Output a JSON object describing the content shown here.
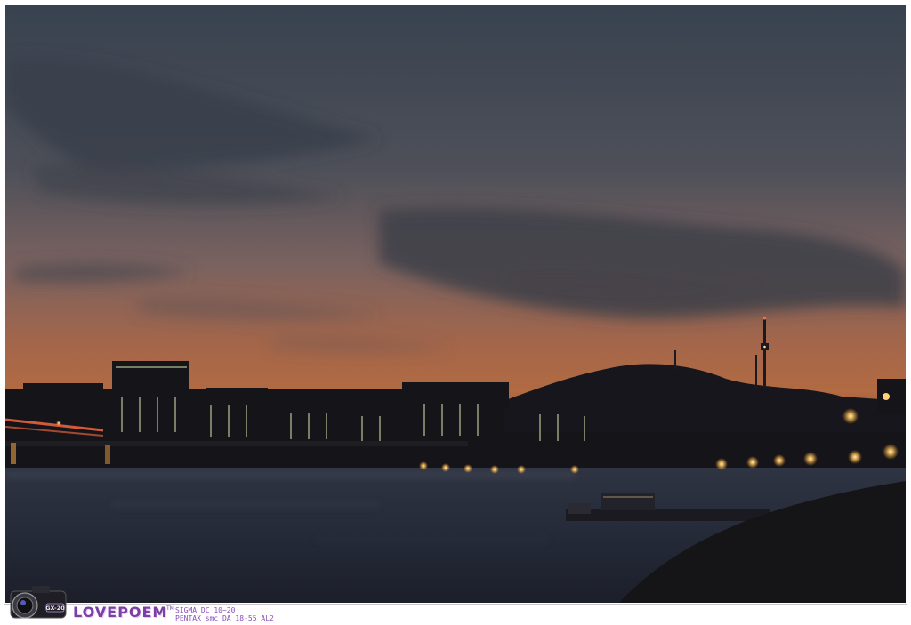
{
  "watermark": {
    "brand": "LOVEPOEM",
    "trademark": "TM",
    "camera_model": "GX-20",
    "lens_line_1": "SIGMA DC 10~20",
    "lens_line_2": "PENTAX smc DA 18-55 AL2"
  },
  "colors": {
    "sky_top": "#3b4653",
    "sky_mid": "#5e5a62",
    "sky_horizon": "#b06a43",
    "city_silhouette": "#16161d",
    "water": "#2b3140",
    "light_glow": "#ffd27a",
    "accent": "#7b3fa6"
  },
  "icons": [
    "camera-icon"
  ]
}
